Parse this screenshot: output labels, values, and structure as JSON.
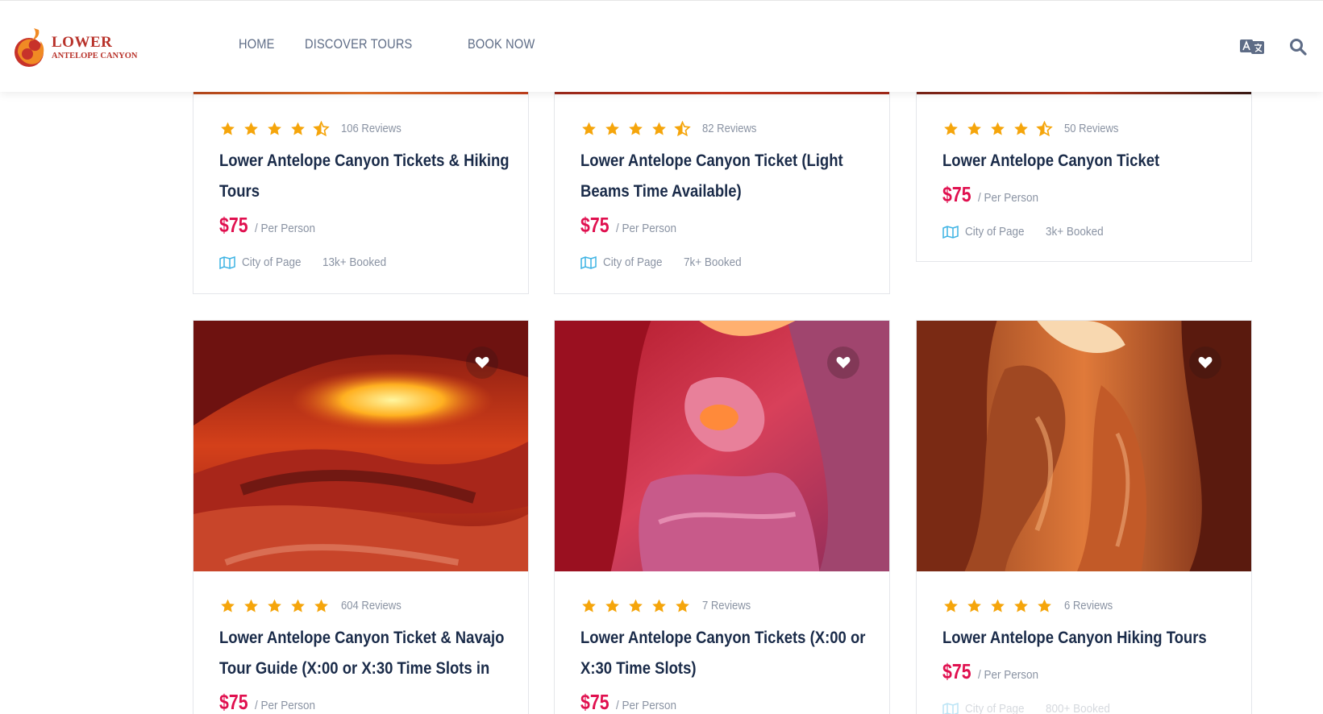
{
  "brand": {
    "name_main": "LOWER",
    "name_sub": "ANTELOPE CANYON",
    "colors": {
      "primary": "#b8322a",
      "flame": "#f08a24"
    }
  },
  "nav": {
    "items": [
      {
        "label": "HOME"
      },
      {
        "label": "DISCOVER TOURS"
      },
      {
        "label": "BOOK NOW"
      }
    ]
  },
  "header_icons": [
    "translate-icon",
    "search-icon"
  ],
  "colors": {
    "price": "#e0104f",
    "star": "#f5a50b",
    "title": "#1a2b49",
    "muted": "#8a93a3",
    "map": "#3db3e4"
  },
  "tours": [
    {
      "rating": 4.5,
      "reviews": "106 Reviews",
      "title": "Lower Antelope Canyon Tickets & Hiking Tours",
      "price": "$75",
      "per": "/ Per Person",
      "location": "City of Page",
      "booked": "13k+ Booked"
    },
    {
      "rating": 4.5,
      "reviews": "82 Reviews",
      "title": "Lower Antelope Canyon Ticket (Light Beams Time Available)",
      "price": "$75",
      "per": "/ Per Person",
      "location": "City of Page",
      "booked": "7k+ Booked"
    },
    {
      "rating": 4.5,
      "reviews": "50 Reviews",
      "title": "Lower Antelope Canyon Ticket",
      "price": "$75",
      "per": "/ Per Person",
      "location": "City of Page",
      "booked": "3k+ Booked"
    },
    {
      "rating": 5,
      "reviews": "604 Reviews",
      "title": "Lower Antelope Canyon Ticket & Navajo Tour Guide (X:00 or X:30 Time Slots in",
      "price": "$75",
      "per": "/ Per Person",
      "location": "",
      "booked": "",
      "image": "canyon-light-beam-red-orange"
    },
    {
      "rating": 5,
      "reviews": "7 Reviews",
      "title": "Lower Antelope Canyon Tickets (X:00 or X:30 Time Slots)",
      "price": "$75",
      "per": "/ Per Person",
      "location": "",
      "booked": "",
      "image": "canyon-pink-purple-arch"
    },
    {
      "rating": 5,
      "reviews": "6 Reviews",
      "title": "Lower Antelope Canyon Hiking Tours",
      "price": "$75",
      "per": "/ Per Person",
      "location": "City of Page",
      "booked": "800+ Booked",
      "image": "canyon-orange-swirl"
    }
  ]
}
